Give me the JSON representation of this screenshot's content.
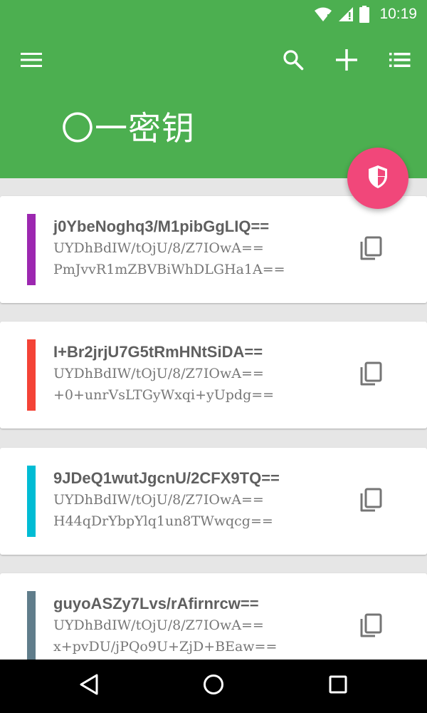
{
  "status_bar": {
    "time": "10:19",
    "icons": [
      "wifi-icon",
      "signal-icon",
      "battery-icon"
    ]
  },
  "toolbar": {
    "icons": [
      "menu-icon",
      "search-icon",
      "add-icon",
      "list-view-icon"
    ]
  },
  "page_title": "〇一密钥",
  "fab": {
    "icon": "shield-icon",
    "color": "#f1477a"
  },
  "colors": {
    "primary": "#4caf50",
    "accent": "#f1477a",
    "background": "#e6e6e6"
  },
  "cards": [
    {
      "title": "j0YbeNoghq3/M1pibGgLIQ==",
      "line1": "UYDhBdIW/tOjU/8/Z7IOwA==",
      "line2": "PmJvvR1mZBVBiWhDLGHa1A==",
      "color": "#9c27b0"
    },
    {
      "title": "I+Br2jrjU7G5tRmHNtSiDA==",
      "line1": "UYDhBdIW/tOjU/8/Z7IOwA==",
      "line2": "+0+unrVsLTGyWxqi+yUpdg==",
      "color": "#f44336"
    },
    {
      "title": "9JDeQ1wutJgcnU/2CFX9TQ==",
      "line1": "UYDhBdIW/tOjU/8/Z7IOwA==",
      "line2": "H44qDrYbpYlq1un8TWwqcg==",
      "color": "#00bcd4"
    },
    {
      "title": "guyoASZy7Lvs/rAfirnrcw==",
      "line1": "UYDhBdIW/tOjU/8/Z7IOwA==",
      "line2": "x+pvDU/jPQo9U+ZjD+BEaw==",
      "color": "#607d8b"
    }
  ],
  "nav_bar": {
    "icons": [
      "back-icon",
      "home-icon",
      "recents-icon"
    ]
  }
}
